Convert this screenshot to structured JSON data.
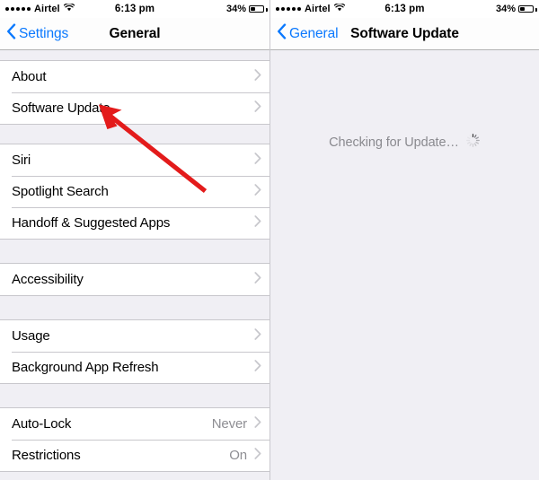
{
  "status_bar": {
    "carrier": "Airtel",
    "signal_dots": 5,
    "wifi_icon": "wifi-icon",
    "time": "6:13 pm",
    "battery_percent": "34%",
    "battery_level": 34
  },
  "left_pane": {
    "nav": {
      "back_label": "Settings",
      "back_icon": "chevron-left-icon",
      "title": "General"
    },
    "groups": [
      {
        "rows": [
          {
            "label": "About",
            "value": "",
            "accessory": "chevron-right-icon"
          },
          {
            "label": "Software Update",
            "value": "",
            "accessory": "chevron-right-icon"
          }
        ]
      },
      {
        "rows": [
          {
            "label": "Siri",
            "value": "",
            "accessory": "chevron-right-icon"
          },
          {
            "label": "Spotlight Search",
            "value": "",
            "accessory": "chevron-right-icon"
          },
          {
            "label": "Handoff & Suggested Apps",
            "value": "",
            "accessory": "chevron-right-icon"
          }
        ]
      },
      {
        "rows": [
          {
            "label": "Accessibility",
            "value": "",
            "accessory": "chevron-right-icon"
          }
        ]
      },
      {
        "rows": [
          {
            "label": "Usage",
            "value": "",
            "accessory": "chevron-right-icon"
          },
          {
            "label": "Background App Refresh",
            "value": "",
            "accessory": "chevron-right-icon"
          }
        ]
      },
      {
        "rows": [
          {
            "label": "Auto-Lock",
            "value": "Never",
            "accessory": "chevron-right-icon"
          },
          {
            "label": "Restrictions",
            "value": "On",
            "accessory": "chevron-right-icon"
          }
        ]
      }
    ]
  },
  "right_pane": {
    "nav": {
      "back_label": "General",
      "back_icon": "chevron-left-icon",
      "title": "Software Update"
    },
    "status": {
      "text": "Checking for Update…",
      "spinner_icon": "loading-spinner-icon"
    }
  },
  "annotation": {
    "arrow_icon": "red-arrow-pointer",
    "color": "#e31b1b",
    "points_to": "Software Update"
  },
  "colors": {
    "accent": "#0b79fe",
    "background": "#f0eff4",
    "row_background": "#ffffff",
    "separator": "#c8c7cc",
    "secondary_text": "#8e8e93",
    "annotation": "#e31b1b"
  }
}
